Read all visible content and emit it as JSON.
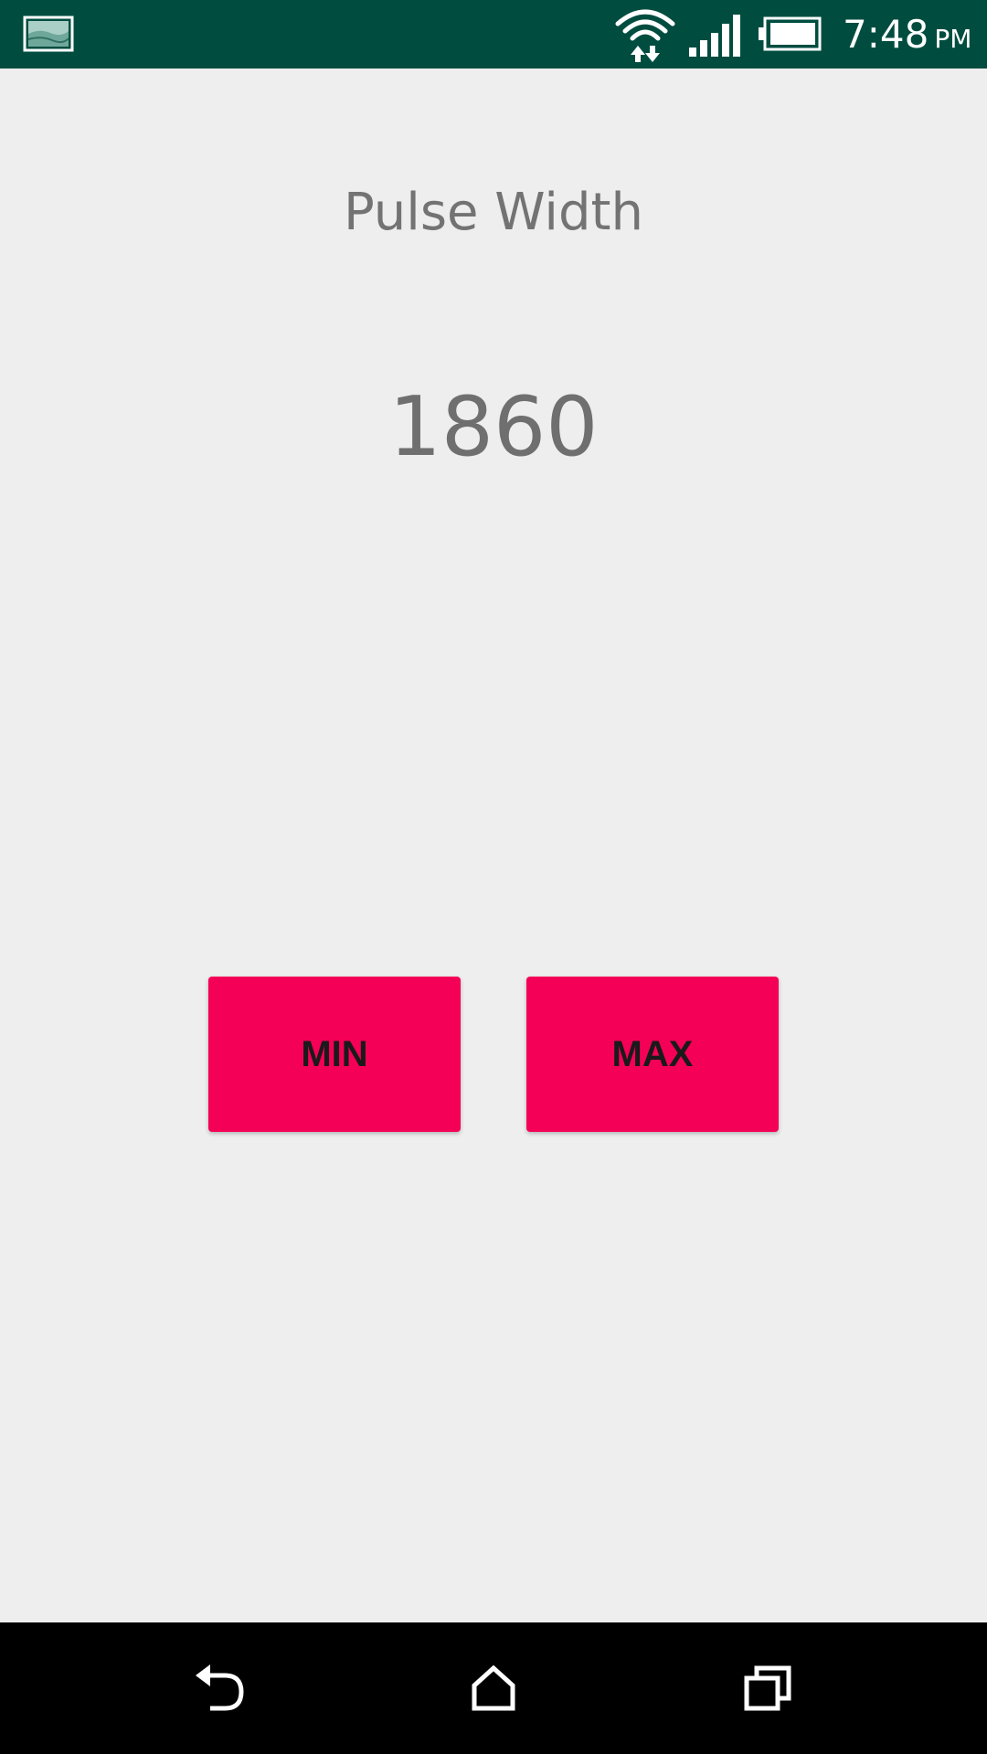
{
  "status_bar": {
    "time": "7:48",
    "ampm": "PM",
    "background_color": "#004d40",
    "icons": [
      "image-notification-icon",
      "wifi-icon",
      "cell-signal-icon",
      "battery-icon"
    ]
  },
  "main": {
    "title": "Pulse Width",
    "value": "1860",
    "buttons": {
      "min_label": "MIN",
      "max_label": "MAX"
    },
    "accent_color": "#f50057",
    "background_color": "#eeeeee"
  },
  "nav_bar": {
    "icons": [
      "back-icon",
      "home-icon",
      "recents-icon"
    ]
  }
}
